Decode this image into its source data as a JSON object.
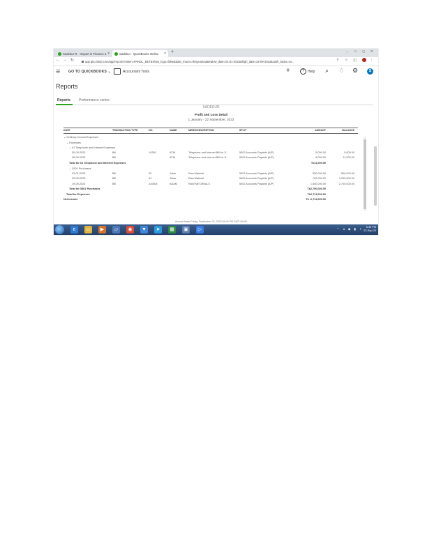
{
  "browser": {
    "tabs": [
      {
        "label": "Sadekur R. - Expert in Finance a",
        "active": false
      },
      {
        "label": "Sadekur - QuickBooks Online",
        "active": true
      }
    ],
    "url": "app.qbo.intuit.com/app/reports?token=PANDL_DET&show_logo=false&date_macro=thisyeartodate&low_date=01-01-2023&high_date=22-09-2023&cash_basis=no..."
  },
  "qbo_nav": {
    "goto_label": "GO TO QUICKBOOKS ⌄",
    "accountant_tools": "Accountant Tools",
    "help": "Help",
    "avatar_initial": "S"
  },
  "page": {
    "title": "Reports",
    "tabs": [
      {
        "label": "Reports",
        "active": true
      },
      {
        "label": "Performance centre",
        "active": false
      }
    ]
  },
  "report": {
    "company": "SADEKUR",
    "name": "Profit and Loss Detail",
    "period": "1 January - 22 September, 2023",
    "columns": [
      "DATE",
      "TRANSACTION TYPE",
      "NO.",
      "NAME",
      "MEMO/DESCRIPTION",
      "SPLIT",
      "AMOUNT",
      "BALANCE"
    ],
    "rows": [
      {
        "kind": "group",
        "indent": 0,
        "label": "⌄  Ordinary Income/Expenses"
      },
      {
        "kind": "group",
        "indent": 1,
        "label": "⌄  Expenses"
      },
      {
        "kind": "group",
        "indent": 2,
        "label": "⌄  61 Telephone and Internet Expenses"
      },
      {
        "kind": "txn",
        "date": "05-09-2023",
        "type": "Bill",
        "no": "14250",
        "name": "AT&t",
        "memo": "Telephone and Internet Bill for S...",
        "split": "5002 Accounts Payable (A/P)",
        "amount": "5,000.00",
        "balance": "5,000.00"
      },
      {
        "kind": "txn",
        "date": "08-09-2023",
        "type": "Bill",
        "no": "",
        "name": "AT&t",
        "memo": "Telephone and Internet Bill for S...",
        "split": "5002 Accounts Payable (A/P)",
        "amount": "6,000.00",
        "balance": "11,000.00"
      },
      {
        "kind": "total",
        "indent": 2,
        "label": "Total for 61 Telephone and Internet Expenses",
        "amount": "Tk11,000.00"
      },
      {
        "kind": "group",
        "indent": 2,
        "label": "⌄  5301 Purchases"
      },
      {
        "kind": "txn",
        "date": "03-01-2023",
        "type": "Bill",
        "no": "03",
        "name": "Johar",
        "memo": "Raw Material",
        "split": "5002 Accounts Payable (A/P)",
        "amount": "500,000.00",
        "balance": "500,000.00"
      },
      {
        "kind": "txn",
        "date": "03-05-2023",
        "type": "Bill",
        "no": "04",
        "name": "Johar",
        "memo": "Raw Material",
        "split": "5002 Accounts Payable (A/P)",
        "amount": "700,000.00",
        "balance": "1,200,000.00"
      },
      {
        "kind": "txn",
        "date": "19-09-2023",
        "type": "Bill",
        "no": "410804",
        "name": "ADAM",
        "memo": "RAW METARIALS",
        "split": "5002 Accounts Payable (A/P)",
        "amount": "1,500,000.00",
        "balance": "2,700,000.00"
      },
      {
        "kind": "total",
        "indent": 2,
        "label": "Total for 5301 Purchases",
        "amount": "Tk2,700,000.00"
      },
      {
        "kind": "total",
        "indent": 1,
        "label": "Total for Expenses",
        "amount": "Tk2,711,000.00"
      },
      {
        "kind": "total",
        "indent": 0,
        "label": "Net Income",
        "amount": "Tk -2,711,000.00"
      }
    ],
    "footer": "Accrual basis  Friday, September 22, 2023  06:49 PM GMT+06:00"
  },
  "taskbar": {
    "clock_time": "6:49 PM",
    "clock_date": "22-Sep-23"
  },
  "colors": {
    "brand_green": "#2ca01c",
    "avatar_blue": "#0077c5",
    "taskbar": "#2c4d7c"
  }
}
